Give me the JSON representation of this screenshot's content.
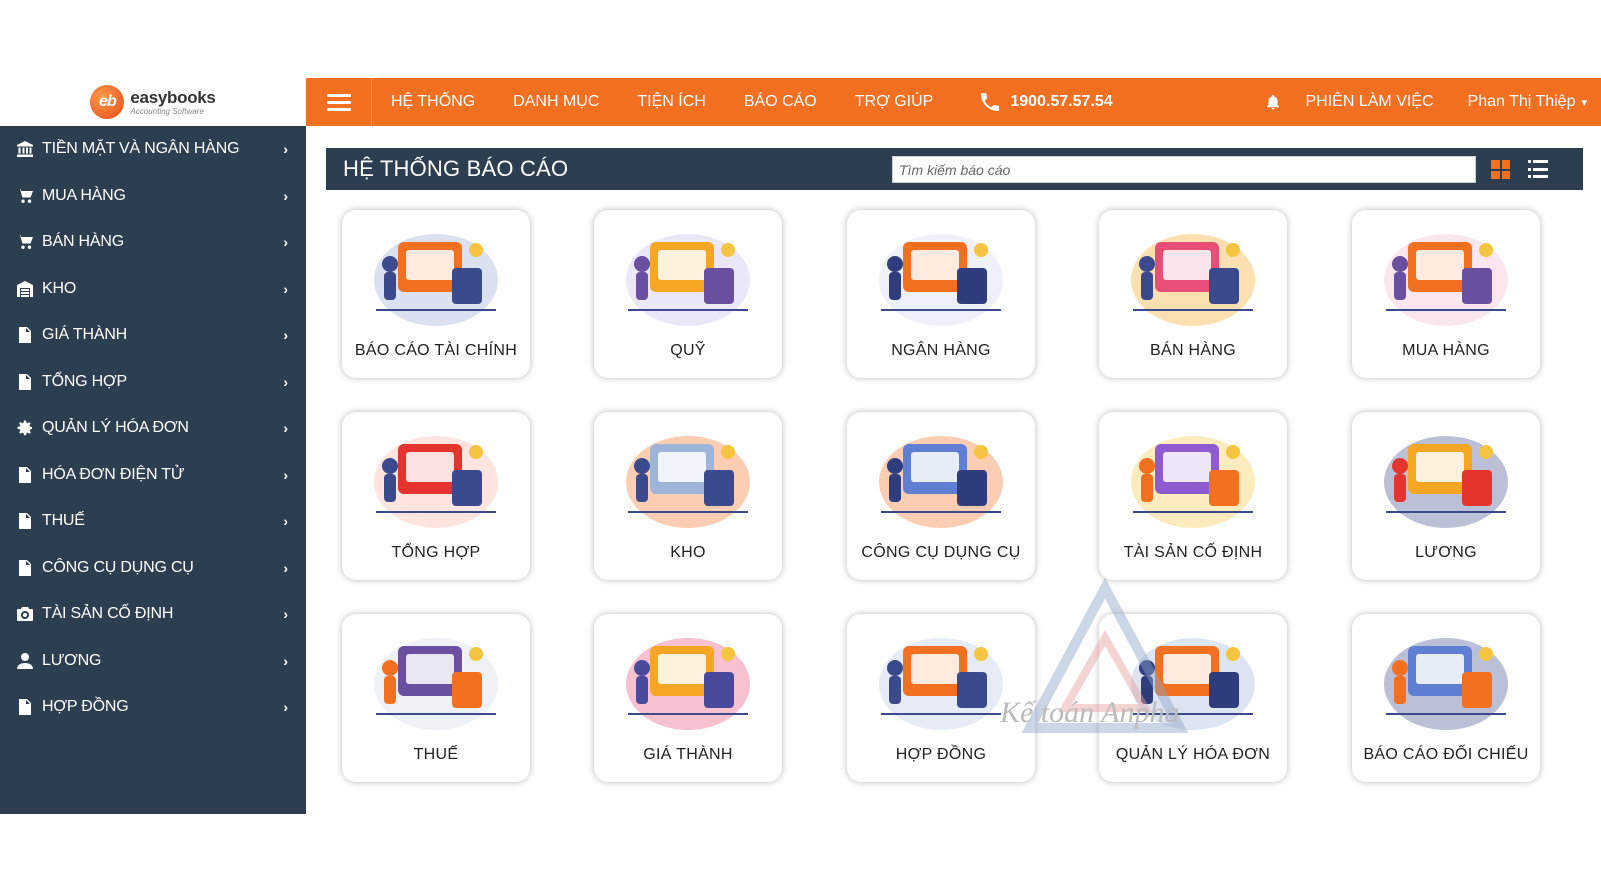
{
  "brand": {
    "name": "easybooks",
    "tagline": "Accounting Software",
    "logo_letters": "eb",
    "accent": "#f37021",
    "dark": "#2c3e50"
  },
  "topbar": {
    "nav": [
      "HỆ THỐNG",
      "DANH MỤC",
      "TIỆN ÍCH",
      "BÁO CÁO",
      "TRỢ GIÚP"
    ],
    "phone": "1900.57.57.54",
    "session": "PHIÊN LÀM VIỆC",
    "user": "Phan Thị Thiệp"
  },
  "sidebar": {
    "items": [
      {
        "label": "TIỀN MẶT VÀ NGÂN HÀNG",
        "icon": "bank-icon"
      },
      {
        "label": "MUA HÀNG",
        "icon": "cart-icon"
      },
      {
        "label": "BÁN HÀNG",
        "icon": "cart-icon"
      },
      {
        "label": "KHO",
        "icon": "warehouse-icon"
      },
      {
        "label": "GIÁ THÀNH",
        "icon": "document-icon"
      },
      {
        "label": "TỔNG HỢP",
        "icon": "document-icon"
      },
      {
        "label": "QUẢN LÝ HÓA ĐƠN",
        "icon": "gear-icon"
      },
      {
        "label": "HÓA ĐƠN ĐIỆN TỬ",
        "icon": "document-icon"
      },
      {
        "label": "THUẾ",
        "icon": "document-icon"
      },
      {
        "label": "CÔNG CỤ DỤNG CỤ",
        "icon": "document-icon"
      },
      {
        "label": "TÀI SẢN CỐ ĐỊNH",
        "icon": "camera-icon"
      },
      {
        "label": "LƯƠNG",
        "icon": "user-icon"
      },
      {
        "label": "HỢP ĐỒNG",
        "icon": "document-icon"
      }
    ]
  },
  "main": {
    "title": "HỆ THỐNG BÁO CÁO",
    "search_placeholder": "Tìm kiếm báo cáo",
    "cards": [
      "BÁO CÁO TÀI CHÍNH",
      "QUỸ",
      "NGÂN HÀNG",
      "BÁN HÀNG",
      "MUA HÀNG",
      "TỔNG HỢP",
      "KHO",
      "CÔNG CỤ DỤNG CỤ",
      "TÀI SẢN CỐ ĐỊNH",
      "LƯƠNG",
      "THUẾ",
      "GIÁ THÀNH",
      "HỢP ĐỒNG",
      "QUẢN LÝ HÓA ĐƠN",
      "BÁO CÁO ĐỐI CHIẾU"
    ]
  },
  "watermark": "Kế toán Anpha"
}
